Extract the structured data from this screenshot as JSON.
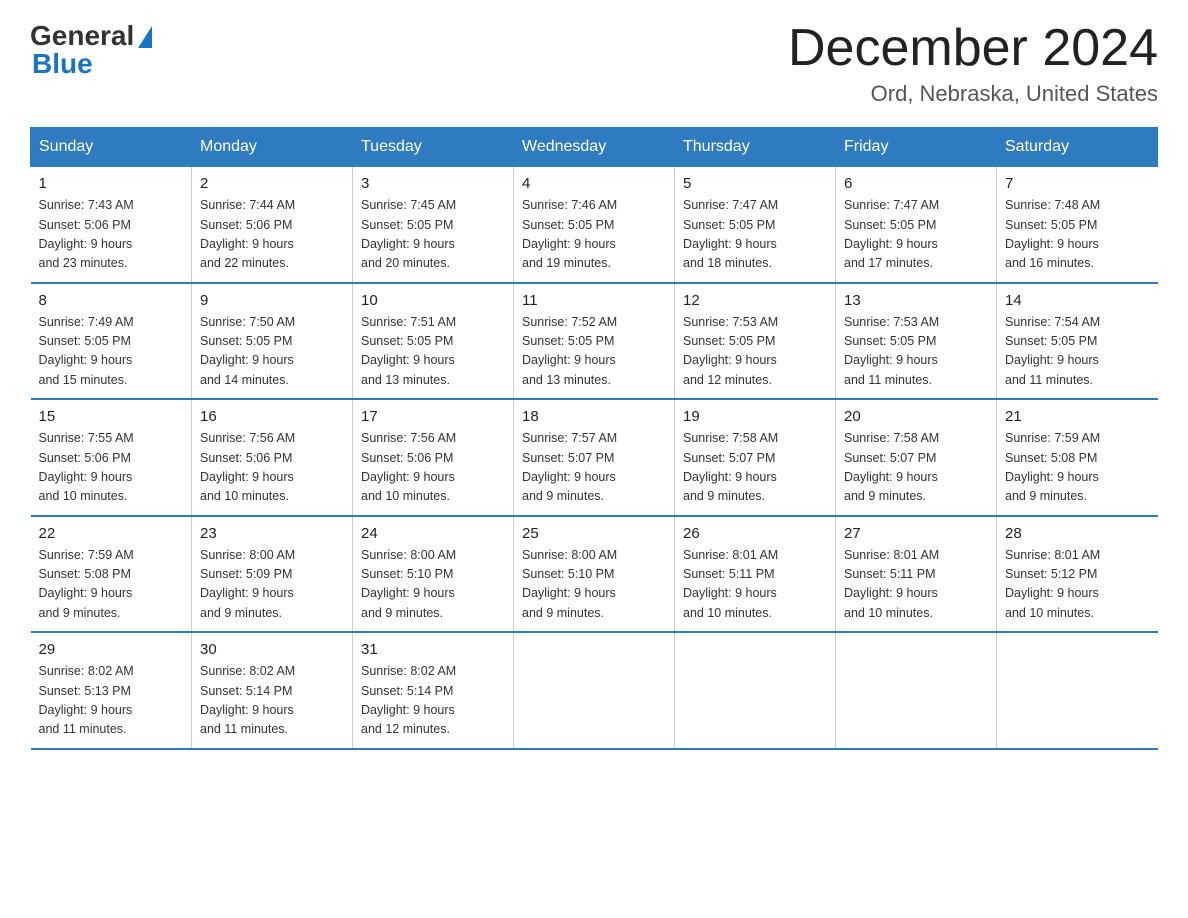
{
  "header": {
    "logo_general": "General",
    "logo_blue": "Blue",
    "month_title": "December 2024",
    "location": "Ord, Nebraska, United States"
  },
  "weekdays": [
    "Sunday",
    "Monday",
    "Tuesday",
    "Wednesday",
    "Thursday",
    "Friday",
    "Saturday"
  ],
  "weeks": [
    [
      {
        "day": "1",
        "sunrise": "7:43 AM",
        "sunset": "5:06 PM",
        "daylight": "9 hours and 23 minutes."
      },
      {
        "day": "2",
        "sunrise": "7:44 AM",
        "sunset": "5:06 PM",
        "daylight": "9 hours and 22 minutes."
      },
      {
        "day": "3",
        "sunrise": "7:45 AM",
        "sunset": "5:05 PM",
        "daylight": "9 hours and 20 minutes."
      },
      {
        "day": "4",
        "sunrise": "7:46 AM",
        "sunset": "5:05 PM",
        "daylight": "9 hours and 19 minutes."
      },
      {
        "day": "5",
        "sunrise": "7:47 AM",
        "sunset": "5:05 PM",
        "daylight": "9 hours and 18 minutes."
      },
      {
        "day": "6",
        "sunrise": "7:47 AM",
        "sunset": "5:05 PM",
        "daylight": "9 hours and 17 minutes."
      },
      {
        "day": "7",
        "sunrise": "7:48 AM",
        "sunset": "5:05 PM",
        "daylight": "9 hours and 16 minutes."
      }
    ],
    [
      {
        "day": "8",
        "sunrise": "7:49 AM",
        "sunset": "5:05 PM",
        "daylight": "9 hours and 15 minutes."
      },
      {
        "day": "9",
        "sunrise": "7:50 AM",
        "sunset": "5:05 PM",
        "daylight": "9 hours and 14 minutes."
      },
      {
        "day": "10",
        "sunrise": "7:51 AM",
        "sunset": "5:05 PM",
        "daylight": "9 hours and 13 minutes."
      },
      {
        "day": "11",
        "sunrise": "7:52 AM",
        "sunset": "5:05 PM",
        "daylight": "9 hours and 13 minutes."
      },
      {
        "day": "12",
        "sunrise": "7:53 AM",
        "sunset": "5:05 PM",
        "daylight": "9 hours and 12 minutes."
      },
      {
        "day": "13",
        "sunrise": "7:53 AM",
        "sunset": "5:05 PM",
        "daylight": "9 hours and 11 minutes."
      },
      {
        "day": "14",
        "sunrise": "7:54 AM",
        "sunset": "5:05 PM",
        "daylight": "9 hours and 11 minutes."
      }
    ],
    [
      {
        "day": "15",
        "sunrise": "7:55 AM",
        "sunset": "5:06 PM",
        "daylight": "9 hours and 10 minutes."
      },
      {
        "day": "16",
        "sunrise": "7:56 AM",
        "sunset": "5:06 PM",
        "daylight": "9 hours and 10 minutes."
      },
      {
        "day": "17",
        "sunrise": "7:56 AM",
        "sunset": "5:06 PM",
        "daylight": "9 hours and 10 minutes."
      },
      {
        "day": "18",
        "sunrise": "7:57 AM",
        "sunset": "5:07 PM",
        "daylight": "9 hours and 9 minutes."
      },
      {
        "day": "19",
        "sunrise": "7:58 AM",
        "sunset": "5:07 PM",
        "daylight": "9 hours and 9 minutes."
      },
      {
        "day": "20",
        "sunrise": "7:58 AM",
        "sunset": "5:07 PM",
        "daylight": "9 hours and 9 minutes."
      },
      {
        "day": "21",
        "sunrise": "7:59 AM",
        "sunset": "5:08 PM",
        "daylight": "9 hours and 9 minutes."
      }
    ],
    [
      {
        "day": "22",
        "sunrise": "7:59 AM",
        "sunset": "5:08 PM",
        "daylight": "9 hours and 9 minutes."
      },
      {
        "day": "23",
        "sunrise": "8:00 AM",
        "sunset": "5:09 PM",
        "daylight": "9 hours and 9 minutes."
      },
      {
        "day": "24",
        "sunrise": "8:00 AM",
        "sunset": "5:10 PM",
        "daylight": "9 hours and 9 minutes."
      },
      {
        "day": "25",
        "sunrise": "8:00 AM",
        "sunset": "5:10 PM",
        "daylight": "9 hours and 9 minutes."
      },
      {
        "day": "26",
        "sunrise": "8:01 AM",
        "sunset": "5:11 PM",
        "daylight": "9 hours and 10 minutes."
      },
      {
        "day": "27",
        "sunrise": "8:01 AM",
        "sunset": "5:11 PM",
        "daylight": "9 hours and 10 minutes."
      },
      {
        "day": "28",
        "sunrise": "8:01 AM",
        "sunset": "5:12 PM",
        "daylight": "9 hours and 10 minutes."
      }
    ],
    [
      {
        "day": "29",
        "sunrise": "8:02 AM",
        "sunset": "5:13 PM",
        "daylight": "9 hours and 11 minutes."
      },
      {
        "day": "30",
        "sunrise": "8:02 AM",
        "sunset": "5:14 PM",
        "daylight": "9 hours and 11 minutes."
      },
      {
        "day": "31",
        "sunrise": "8:02 AM",
        "sunset": "5:14 PM",
        "daylight": "9 hours and 12 minutes."
      },
      null,
      null,
      null,
      null
    ]
  ]
}
